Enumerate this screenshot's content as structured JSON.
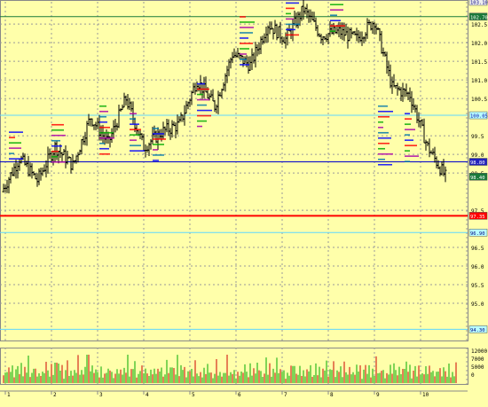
{
  "chart_data": {
    "type": "ohlc",
    "price_axis": {
      "ylim": [
        94.0,
        103.1
      ],
      "tick_labels": [
        "102.5",
        "102.0",
        "101.5",
        "101.0",
        "100.5",
        "99.5",
        "99.0",
        "98.5",
        "97.5",
        "96.5",
        "96.0",
        "95.5",
        "95.0"
      ]
    },
    "price_markers": [
      {
        "label": "103.10",
        "bg": "#eeeeee",
        "fg": "#000080"
      },
      {
        "label": "102.70",
        "bg": "#1a7a3a",
        "fg": "#ffffff"
      },
      {
        "label": "100.05",
        "bg": "#b8ffff",
        "fg": "#0000aa"
      },
      {
        "label": "98.80",
        "bg": "#2222bb",
        "fg": "#ffffff"
      },
      {
        "label": "98.40",
        "bg": "#1a7a3a",
        "fg": "#ffffff"
      },
      {
        "label": "97.35",
        "bg": "#ff0000",
        "fg": "#ffffff"
      },
      {
        "label": "96.90",
        "bg": "#b8ffff",
        "fg": "#000080"
      },
      {
        "label": "94.30",
        "bg": "#b8ffff",
        "fg": "#000080"
      }
    ],
    "horizontal_levels": [
      {
        "value": 102.7,
        "color": "#1a7a3a"
      },
      {
        "value": 100.05,
        "color": "#5fd7ff"
      },
      {
        "value": 98.8,
        "color": "#0000cc"
      },
      {
        "value": 97.35,
        "color": "#ff0000"
      },
      {
        "value": 96.9,
        "color": "#5fd7ff"
      },
      {
        "value": 94.3,
        "color": "#5fd7ff"
      }
    ],
    "volume_axis": {
      "tick_labels": [
        "12000",
        "7000",
        "5000",
        "0"
      ]
    },
    "date_labels": [
      "1",
      "2",
      "3",
      "4",
      "5",
      "6",
      "7",
      "8",
      "9",
      "10"
    ],
    "ohlc_segments": [
      {
        "start": 98.0,
        "end": 98.9
      },
      {
        "start": 98.9,
        "end": 98.3
      },
      {
        "start": 98.3,
        "end": 99.2
      },
      {
        "start": 99.2,
        "end": 98.7
      },
      {
        "start": 98.7,
        "end": 100.0
      },
      {
        "start": 100.0,
        "end": 99.3
      },
      {
        "start": 99.3,
        "end": 100.5
      },
      {
        "start": 100.5,
        "end": 99.2
      },
      {
        "start": 99.2,
        "end": 99.6
      },
      {
        "start": 99.6,
        "end": 99.8
      },
      {
        "start": 99.8,
        "end": 101.0
      },
      {
        "start": 101.0,
        "end": 100.3
      },
      {
        "start": 100.3,
        "end": 101.7
      },
      {
        "start": 101.7,
        "end": 101.4
      },
      {
        "start": 101.4,
        "end": 102.5
      },
      {
        "start": 102.5,
        "end": 102.1
      },
      {
        "start": 102.1,
        "end": 102.9
      },
      {
        "start": 102.9,
        "end": 102.2
      },
      {
        "start": 102.2,
        "end": 102.3
      },
      {
        "start": 102.3,
        "end": 102.1
      },
      {
        "start": 102.1,
        "end": 102.6
      },
      {
        "start": 102.6,
        "end": 100.8
      },
      {
        "start": 100.8,
        "end": 100.6
      },
      {
        "start": 100.6,
        "end": 99.2
      },
      {
        "start": 99.2,
        "end": 98.4
      }
    ],
    "volume_pattern": [
      0.25,
      0.45,
      0.3,
      0.6,
      0.35,
      0.5,
      0.2,
      0.4,
      0.7,
      0.3,
      0.55,
      0.25,
      0.45,
      0.35,
      0.8,
      0.3,
      0.5,
      0.4,
      0.6,
      0.2,
      0.45,
      0.35,
      0.5,
      0.3,
      0.65,
      0.4,
      0.25,
      0.55
    ],
    "spikes": [
      {
        "pos": 0.185,
        "height": 1.0
      },
      {
        "pos": 0.115,
        "height": 0.72
      },
      {
        "pos": 0.37,
        "height": 0.55
      },
      {
        "pos": 0.64,
        "height": 0.6
      },
      {
        "pos": 0.88,
        "height": 0.5
      }
    ]
  }
}
